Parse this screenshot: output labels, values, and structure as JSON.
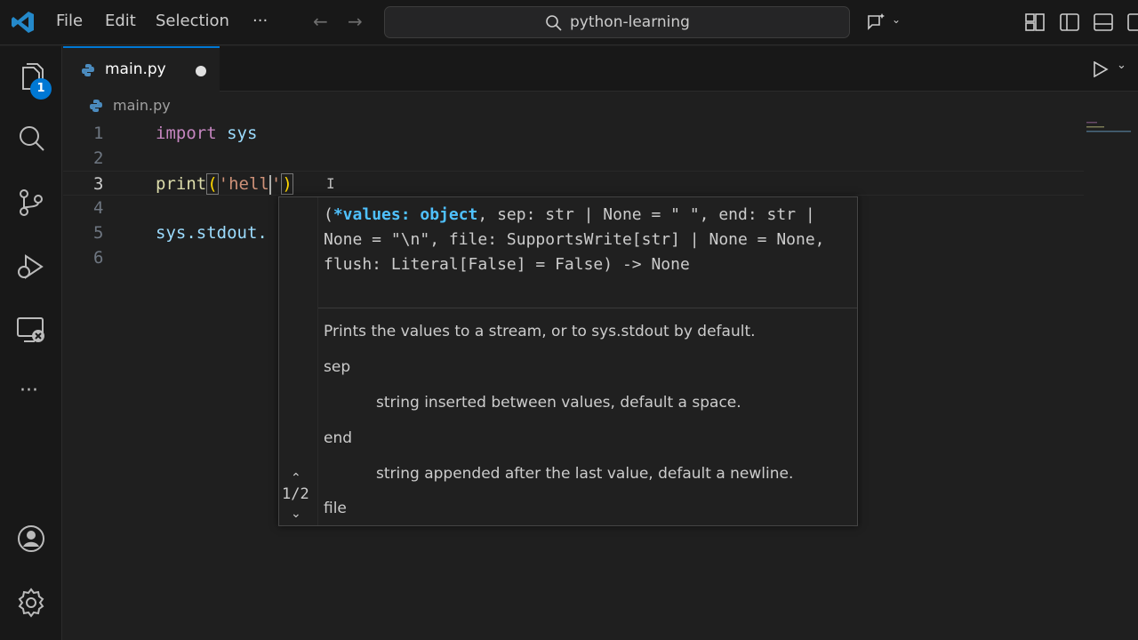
{
  "menu": {
    "file": "File",
    "edit": "Edit",
    "selection": "Selection",
    "more": "···"
  },
  "search": {
    "text": "python-learning"
  },
  "explorer_badge": "1",
  "tab": {
    "name": "main.py"
  },
  "breadcrumb": {
    "file": "main.py"
  },
  "editor": {
    "line_numbers": [
      "1",
      "2",
      "3",
      "4",
      "5",
      "6"
    ],
    "line1": {
      "kw": "import",
      "mod": "sys"
    },
    "line3": {
      "fn": "print",
      "open": "(",
      "str_open": "'hell",
      "str_close": "'",
      "close": ")"
    },
    "line5": {
      "text": "sys.stdout."
    }
  },
  "signature_help": {
    "counter": "1/2",
    "sig_open": "(",
    "sig_active": "*values: object",
    "sig_rest": ", sep: str | None = \" \", end: str | None = \"\\n\", file: SupportsWrite[str] | None = None, flush: Literal[False] = False) -> None",
    "description": "Prints the values to a stream, or to sys.stdout by default.",
    "params": [
      {
        "name": "sep",
        "doc": "string inserted between values, default a space."
      },
      {
        "name": "end",
        "doc": "string appended after the last value, default a newline."
      },
      {
        "name": "file"
      }
    ]
  },
  "colors": {
    "accent": "#0078d4",
    "keyword": "#c586c0",
    "function": "#dcdcaa",
    "string": "#ce9178",
    "active_param": "#4fc1ff"
  }
}
